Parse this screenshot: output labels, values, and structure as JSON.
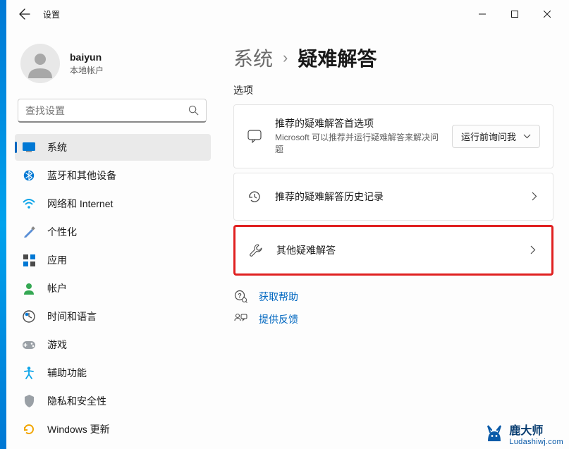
{
  "app": {
    "title": "设置"
  },
  "user": {
    "name": "baiyun",
    "subtitle": "本地帐户"
  },
  "search": {
    "placeholder": "查找设置"
  },
  "nav": {
    "items": [
      {
        "label": "系统",
        "icon": "system",
        "selected": true
      },
      {
        "label": "蓝牙和其他设备",
        "icon": "bluetooth"
      },
      {
        "label": "网络和 Internet",
        "icon": "network"
      },
      {
        "label": "个性化",
        "icon": "personalize"
      },
      {
        "label": "应用",
        "icon": "apps"
      },
      {
        "label": "帐户",
        "icon": "account"
      },
      {
        "label": "时间和语言",
        "icon": "time"
      },
      {
        "label": "游戏",
        "icon": "gaming"
      },
      {
        "label": "辅助功能",
        "icon": "accessibility"
      },
      {
        "label": "隐私和安全性",
        "icon": "privacy"
      },
      {
        "label": "Windows 更新",
        "icon": "update"
      }
    ]
  },
  "breadcrumb": {
    "root": "系统",
    "current": "疑难解答"
  },
  "section": {
    "label": "选项"
  },
  "cards": {
    "recommended": {
      "title": "推荐的疑难解答首选项",
      "desc": "Microsoft 可以推荐并运行疑难解答来解决问题",
      "dropdown": "运行前询问我"
    },
    "history": {
      "title": "推荐的疑难解答历史记录"
    },
    "other": {
      "title": "其他疑难解答"
    }
  },
  "footer": {
    "help": "获取帮助",
    "feedback": "提供反馈"
  },
  "watermark": {
    "cn": "鹿大师",
    "en": "Ludashiwj.com"
  }
}
